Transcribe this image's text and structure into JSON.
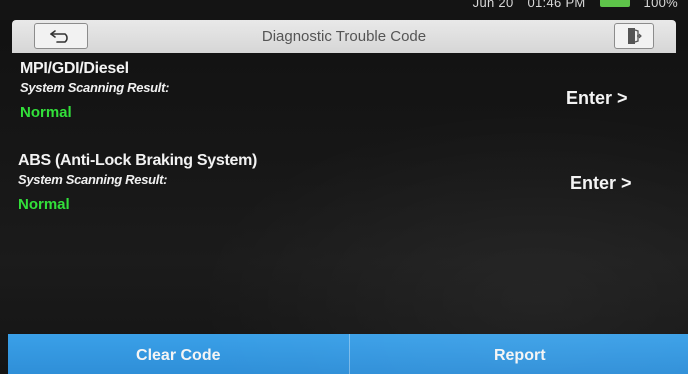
{
  "status_bar": {
    "date": "Jun 20",
    "time": "01:46 PM",
    "battery": "100%"
  },
  "header": {
    "title": "Diagnostic Trouble Code",
    "back_icon": "back-arrow-icon",
    "exit_icon": "exit-door-icon"
  },
  "systems": [
    {
      "name": "MPI/GDI/Diesel",
      "subtitle": "System Scanning Result:",
      "status": "Normal",
      "action": "Enter >"
    },
    {
      "name": "ABS (Anti-Lock Braking System)",
      "subtitle": "System Scanning Result:",
      "status": "Normal",
      "action": "Enter >"
    }
  ],
  "footer": {
    "clear_code": "Clear Code",
    "report": "Report"
  },
  "colors": {
    "status_normal": "#32e03a",
    "footer_bg": "#3aa0e8",
    "header_bg": "#e0e0e0"
  }
}
